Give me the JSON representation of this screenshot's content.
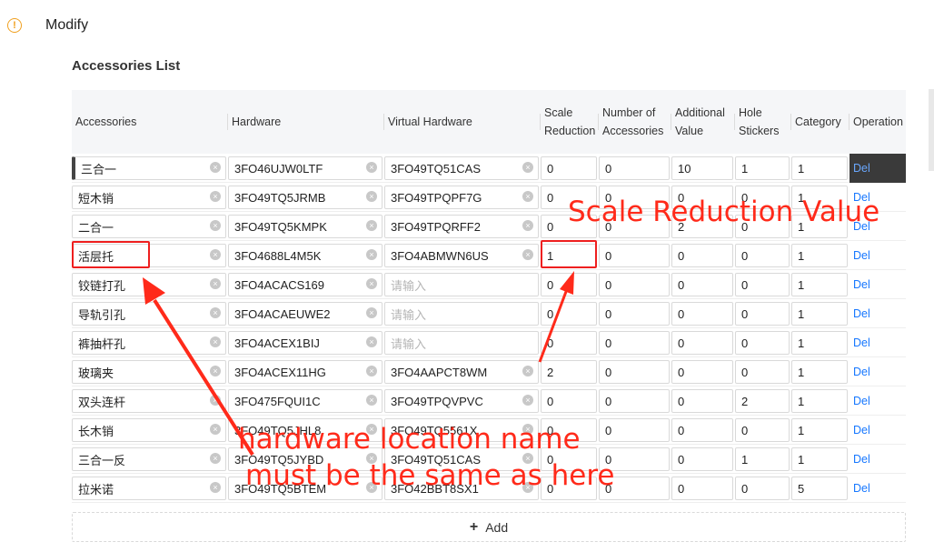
{
  "header": {
    "title": "Modify",
    "icon": "warning-circle-icon"
  },
  "section_title": "Accessories List",
  "columns": [
    {
      "key": "accessories",
      "label": "Accessories"
    },
    {
      "key": "hardware",
      "label": "Hardware"
    },
    {
      "key": "virtual",
      "label": "Virtual Hardware"
    },
    {
      "key": "scale",
      "label": "Scale Reduction"
    },
    {
      "key": "number",
      "label": "Number of Accessories"
    },
    {
      "key": "additional",
      "label": "Additional Value"
    },
    {
      "key": "hole",
      "label": "Hole Stickers"
    },
    {
      "key": "category",
      "label": "Category"
    },
    {
      "key": "operation",
      "label": "Operation"
    }
  ],
  "placeholder": "请输入",
  "rows": [
    {
      "accessories": "三合一",
      "hardware": "3FO46UJW0LTF",
      "virtual": "3FO49TQ51CAS",
      "scale": "0",
      "number": "0",
      "additional": "10",
      "hole": "1",
      "category": "1",
      "op": "Del"
    },
    {
      "accessories": "短木销",
      "hardware": "3FO49TQ5JRMB",
      "virtual": "3FO49TPQPF7G",
      "scale": "0",
      "number": "0",
      "additional": "0",
      "hole": "0",
      "category": "1",
      "op": "Del"
    },
    {
      "accessories": "二合一",
      "hardware": "3FO49TQ5KMPK",
      "virtual": "3FO49TPQRFF2",
      "scale": "0",
      "number": "0",
      "additional": "2",
      "hole": "0",
      "category": "1",
      "op": "Del"
    },
    {
      "accessories": "活层托",
      "hardware": "3FO4688L4M5K",
      "virtual": "3FO4ABMWN6US",
      "scale": "1",
      "number": "0",
      "additional": "0",
      "hole": "0",
      "category": "1",
      "op": "Del"
    },
    {
      "accessories": "铰链打孔",
      "hardware": "3FO4ACACS169",
      "virtual": "",
      "scale": "0",
      "number": "0",
      "additional": "0",
      "hole": "0",
      "category": "1",
      "op": "Del"
    },
    {
      "accessories": "导轨引孔",
      "hardware": "3FO4ACAEUWE2",
      "virtual": "",
      "scale": "0",
      "number": "0",
      "additional": "0",
      "hole": "0",
      "category": "1",
      "op": "Del"
    },
    {
      "accessories": "裤抽杆孔",
      "hardware": "3FO4ACEX1BIJ",
      "virtual": "",
      "scale": "0",
      "number": "0",
      "additional": "0",
      "hole": "0",
      "category": "1",
      "op": "Del"
    },
    {
      "accessories": "玻璃夹",
      "hardware": "3FO4ACEX11HG",
      "virtual": "3FO4AAPCT8WM",
      "scale": "2",
      "number": "0",
      "additional": "0",
      "hole": "0",
      "category": "1",
      "op": "Del"
    },
    {
      "accessories": "双头连杆",
      "hardware": "3FO475FQUI1C",
      "virtual": "3FO49TPQVPVC",
      "scale": "0",
      "number": "0",
      "additional": "0",
      "hole": "2",
      "category": "1",
      "op": "Del"
    },
    {
      "accessories": "长木销",
      "hardware": "3FO49TQ5JHL8",
      "virtual": "3FO49TQ5561X",
      "scale": "0",
      "number": "0",
      "additional": "0",
      "hole": "0",
      "category": "1",
      "op": "Del"
    },
    {
      "accessories": "三合一反",
      "hardware": "3FO49TQ5JYBD",
      "virtual": "3FO49TQ51CAS",
      "scale": "0",
      "number": "0",
      "additional": "0",
      "hole": "1",
      "category": "1",
      "op": "Del"
    },
    {
      "accessories": "拉米诺",
      "hardware": "3FO49TQ5BTEM",
      "virtual": "3FO42BBT8SX1",
      "scale": "0",
      "number": "0",
      "additional": "0",
      "hole": "0",
      "category": "5",
      "op": "Del"
    }
  ],
  "add_button": {
    "label": "Add"
  },
  "annotations": {
    "scale_note": "Scale Reduction Value",
    "hw_note_line1": "hardware location name",
    "hw_note_line2": "must be the same as here",
    "color": "#ff2a1a"
  }
}
